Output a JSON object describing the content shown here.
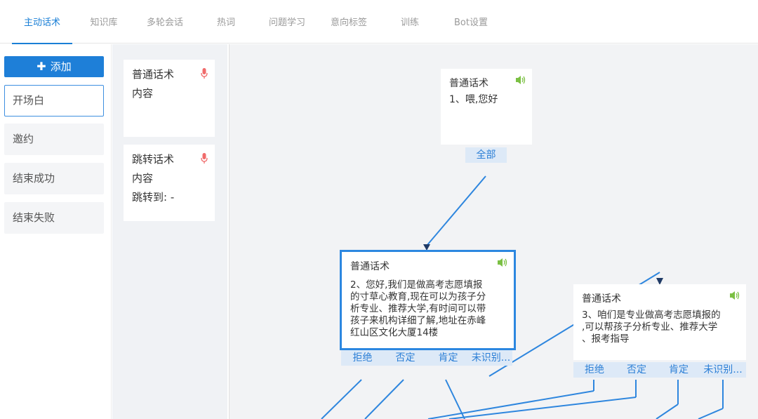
{
  "tabs": [
    {
      "label": "主动话术"
    },
    {
      "label": "知识库"
    },
    {
      "label": "多轮会话"
    },
    {
      "label": "热词"
    },
    {
      "label": "问题学习"
    },
    {
      "label": "意向标签"
    },
    {
      "label": "训练"
    },
    {
      "label": "Bot设置"
    }
  ],
  "left": {
    "add_label": "添加",
    "categories": [
      "开场白",
      "邀约",
      "结束成功",
      "结束失败"
    ]
  },
  "templates": [
    {
      "title": "普通话术",
      "line2": "内容"
    },
    {
      "title": "跳转话术",
      "line2": "内容",
      "line3": "跳转到: -"
    }
  ],
  "nodes": {
    "n1": {
      "title": "普通话术",
      "text": "1、喂,您好",
      "branches": [
        "全部"
      ]
    },
    "n2": {
      "title": "普通话术",
      "lines": [
        "2、您好,我们是做高考志愿填报",
        "的寸草心教育,现在可以为孩子分",
        "析专业、推荐大学,有时间可以带",
        "孩子来机构详细了解,地址在赤峰",
        "红山区文化大厦14楼"
      ],
      "branches": [
        "拒绝",
        "否定",
        "肯定",
        "未识别..."
      ]
    },
    "n3": {
      "title": "普通话术",
      "lines": [
        "3、咱们是专业做高考志愿填报的",
        ",可以帮孩子分析专业、推荐大学",
        "、报考指导"
      ],
      "branches": [
        "拒绝",
        "否定",
        "肯定",
        "未识别..."
      ]
    }
  },
  "colors": {
    "accent": "#1e7fd8",
    "link": "#2e86de",
    "speaker": "#7bc043",
    "mic": "#f06b6b"
  }
}
